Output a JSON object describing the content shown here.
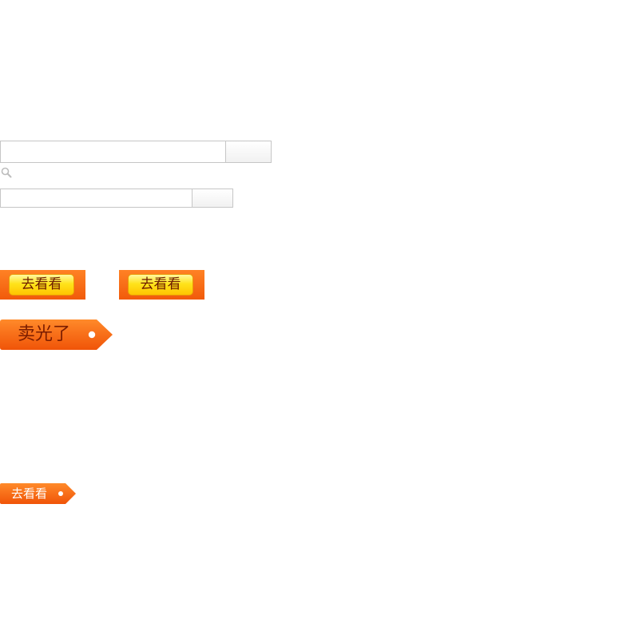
{
  "search_primary": {
    "value": "",
    "button_label": ""
  },
  "search_secondary": {
    "value": "",
    "button_label": ""
  },
  "icons": {
    "magnifier": "search-icon"
  },
  "buttons": {
    "go_see_1": "去看看",
    "go_see_2": "去看看",
    "sold_out_tag": "卖光了",
    "go_see_tag": "去看看"
  },
  "colors": {
    "orange_top": "#ff8224",
    "orange_bottom": "#f15a0b",
    "pill_yellow": "#ffe31a",
    "pill_text": "#6b1a00",
    "tag_text_dark": "#7a1c00",
    "tag_text_light": "#ffffff",
    "border_gray": "#c6c6c6"
  }
}
